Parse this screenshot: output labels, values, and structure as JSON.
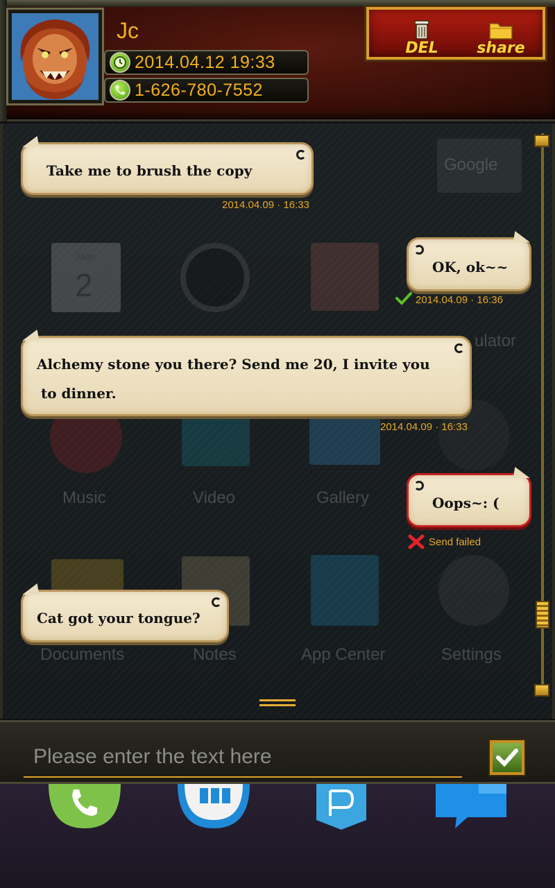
{
  "header": {
    "contact_name": "Jc",
    "datetime": "2014.04.12  19:33",
    "phone": "1-626-780-7552",
    "actions": {
      "delete_label": "DEL",
      "share_label": "share"
    }
  },
  "background_launcher": {
    "search_label": "Google",
    "calendar_day": "Mon",
    "calendar_date": "2",
    "calculator_partial": "ulator",
    "apps_row2": [
      "Music",
      "Video",
      "Gallery"
    ],
    "apps_row3": [
      "Documents",
      "Notes",
      "App Center",
      "Settings"
    ]
  },
  "messages": [
    {
      "direction": "incoming",
      "text": "Take me to brush the copy",
      "timestamp": "2014.04.09 · 16:33"
    },
    {
      "direction": "outgoing",
      "text": "OK, ok~~",
      "timestamp": "2014.04.09 · 16:36",
      "status": "sent"
    },
    {
      "direction": "incoming",
      "text": "Alchemy stone you there? Send me 20, I invite you",
      "text_line2": "to dinner.",
      "timestamp": "2014.04.09 · 16:33"
    },
    {
      "direction": "outgoing",
      "text": "Oops~: (",
      "status": "failed",
      "status_text": "Send failed"
    },
    {
      "direction": "incoming",
      "text": "Cat got your tongue?"
    }
  ],
  "input": {
    "placeholder": "Please enter the text here"
  },
  "colors": {
    "accent_gold": "#f3b01e",
    "header_red": "#5a1a10",
    "bubble": "#f0e5ca",
    "failed_red": "#c62020",
    "sent_green": "#5cbf2a"
  },
  "icons": {
    "time": "clock-icon",
    "phone": "phone-icon",
    "delete": "trash-icon",
    "share": "folder-icon",
    "send": "checkmark-icon"
  }
}
